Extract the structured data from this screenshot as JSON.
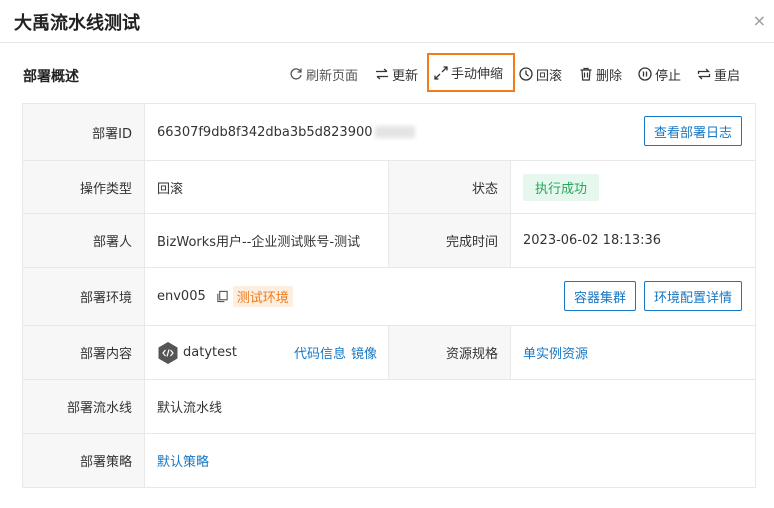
{
  "dialog": {
    "title": "大禹流水线测试",
    "close_icon": "×"
  },
  "section": {
    "title": "部署概述"
  },
  "toolbar": {
    "refresh": "刷新页面",
    "update": "更新",
    "expand": "手动伸缩",
    "rollback": "回滚",
    "delete": "删除",
    "stop": "停止",
    "restart": "重启"
  },
  "rows": {
    "deploy_id": {
      "label": "部署ID",
      "value": "66307f9db8f342dba3b5d823900",
      "button": "查看部署日志"
    },
    "op_type": {
      "label": "操作类型",
      "value": "回滚"
    },
    "status": {
      "label": "状态",
      "value": "执行成功"
    },
    "deployer": {
      "label": "部署人",
      "value": "BizWorks用户--企业测试账号-测试"
    },
    "finish_time": {
      "label": "完成时间",
      "value": "2023-06-02 18:13:36"
    },
    "env": {
      "label": "部署环境",
      "value": "env005",
      "tag": "测试环境",
      "btn_cluster": "容器集群",
      "btn_config": "环境配置详情"
    },
    "content": {
      "label": "部署内容",
      "app": "datytest",
      "code_info": "代码信息",
      "image": "镜像"
    },
    "resource": {
      "label": "资源规格",
      "value": "单实例资源"
    },
    "pipeline": {
      "label": "部署流水线",
      "value": "默认流水线"
    },
    "strategy": {
      "label": "部署策略",
      "value": "默认策略"
    }
  },
  "colors": {
    "accent": "#1677c4",
    "success": "#27a55a",
    "warning": "#f07c1a"
  }
}
